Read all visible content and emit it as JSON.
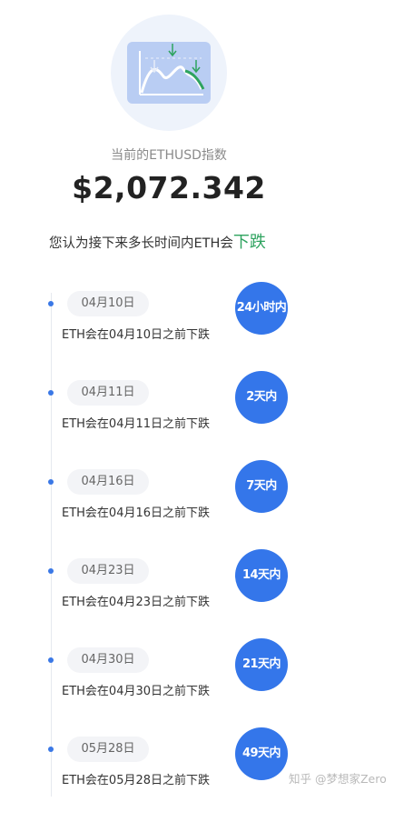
{
  "header": {
    "subtitle": "当前的ETHUSD指数",
    "price": "$2,072.342"
  },
  "question": {
    "prefix": "您认为接下来多长时间内ETH会",
    "direction": "下跌",
    "direction_color": "#2ea35f"
  },
  "accent_color": "#3476ea",
  "timeline": [
    {
      "date": "04月10日",
      "desc": "ETH会在04月10日之前下跌",
      "period": "24小时内"
    },
    {
      "date": "04月11日",
      "desc": "ETH会在04月11日之前下跌",
      "period": "2天内"
    },
    {
      "date": "04月16日",
      "desc": "ETH会在04月16日之前下跌",
      "period": "7天内"
    },
    {
      "date": "04月23日",
      "desc": "ETH会在04月23日之前下跌",
      "period": "14天内"
    },
    {
      "date": "04月30日",
      "desc": "ETH会在04月30日之前下跌",
      "period": "21天内"
    },
    {
      "date": "05月28日",
      "desc": "ETH会在05月28日之前下跌",
      "period": "49天内"
    }
  ],
  "watermark": "知乎 @梦想家Zero"
}
